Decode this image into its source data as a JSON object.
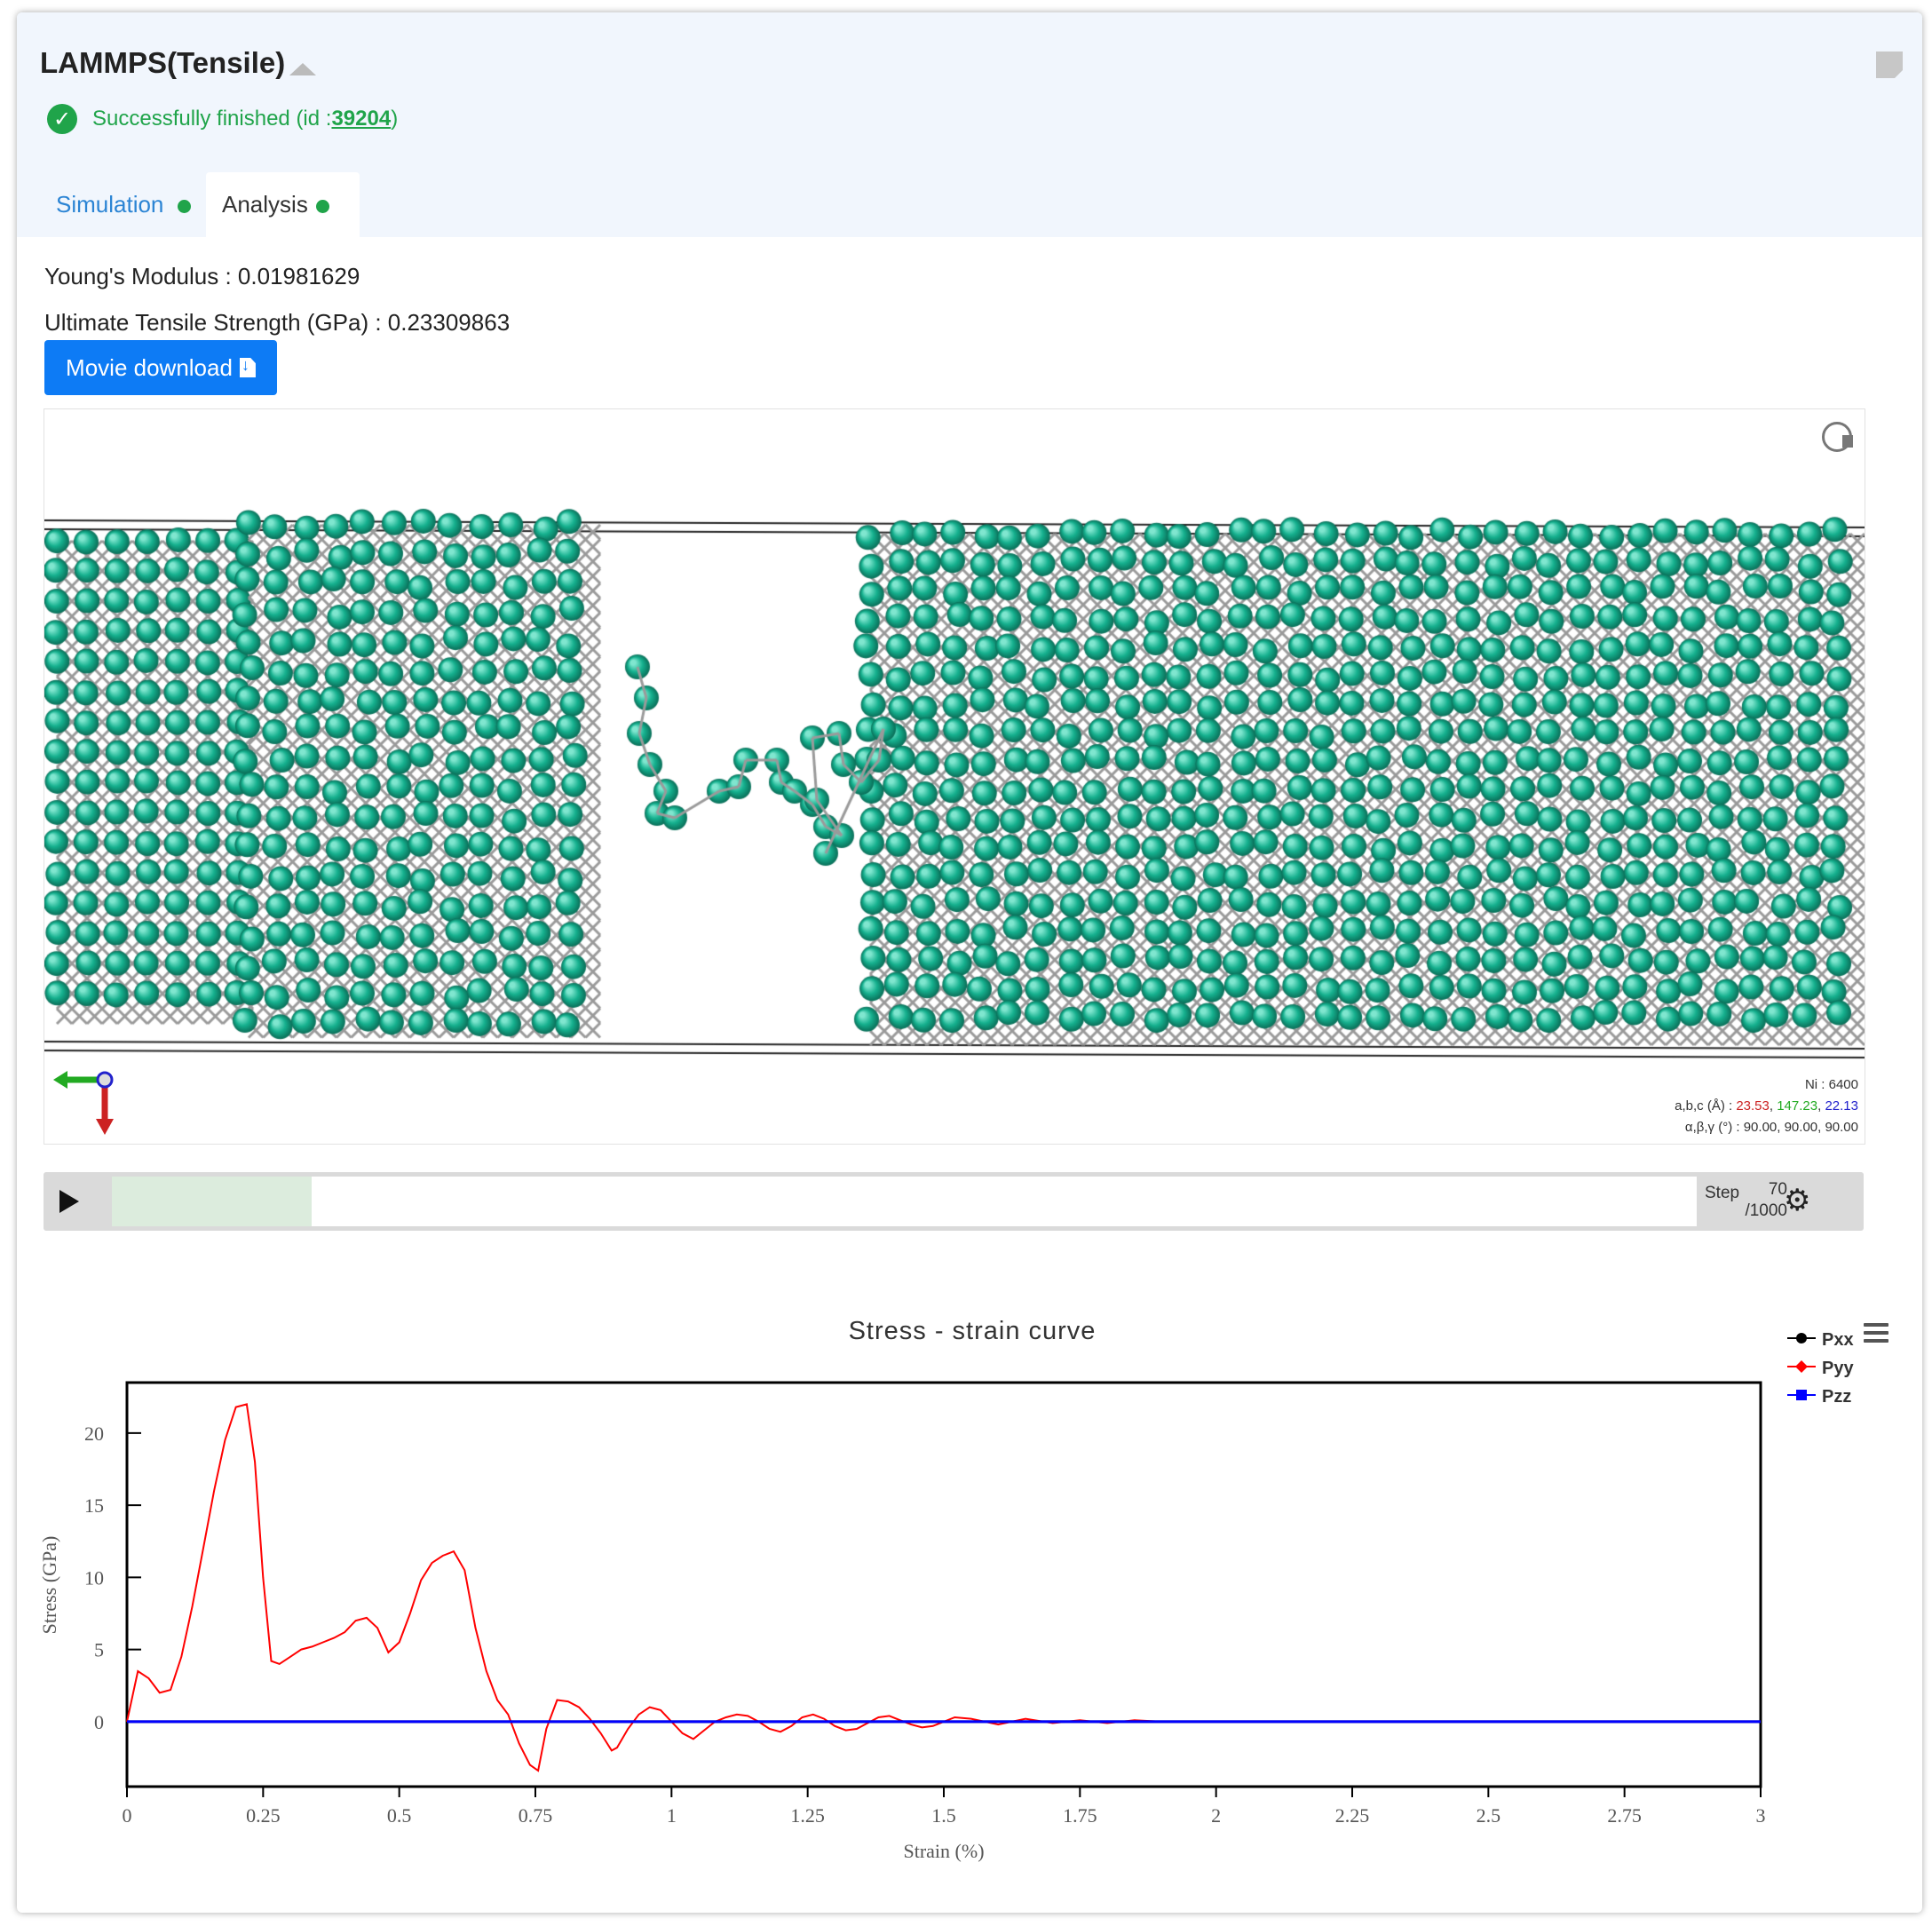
{
  "header": {
    "title": "LAMMPS(Tensile)",
    "status_prefix": "Successfully finished (id : ",
    "status_id": "39204",
    "status_suffix": ")"
  },
  "tabs": [
    {
      "label": "Simulation",
      "active": false
    },
    {
      "label": "Analysis",
      "active": true
    }
  ],
  "metrics": {
    "youngs_modulus": "Young's Modulus : 0.01981629",
    "uts": "Ultimate Tensile Strength (GPa) : 0.23309863"
  },
  "movie_button": {
    "label": "Movie download"
  },
  "viewer": {
    "atom_count": "Ni : 6400",
    "lattice_prefix": "a,b,c (Å) : ",
    "lattice_a": "23.53",
    "lattice_b": "147.23",
    "lattice_c": "22.13",
    "angles": "α,β,γ (°) : 90.00, 90.00, 90.00",
    "atom_color": "#15b08e",
    "bond_color": "#9a9a9a",
    "axis_colors": {
      "x": "#cc2222",
      "y": "#22aa22",
      "z": "#2222cc"
    }
  },
  "player": {
    "step_label": "Step",
    "step_current": "70",
    "step_total": "/1000",
    "progress": 0.07
  },
  "chart_data": {
    "type": "line",
    "title": "Stress - strain curve",
    "xlabel": "Strain (%)",
    "ylabel": "Stress (GPa)",
    "xlim": [
      0,
      3
    ],
    "ylim": [
      -4.5,
      23.5
    ],
    "xticks": [
      "0",
      "0.25",
      "0.5",
      "0.75",
      "1",
      "1.25",
      "1.5",
      "1.75",
      "2",
      "2.25",
      "2.5",
      "2.75",
      "3"
    ],
    "yticks": [
      "0",
      "5",
      "10",
      "15",
      "20"
    ],
    "legend_position": "top-right",
    "series": [
      {
        "name": "Pxx",
        "color": "#000000",
        "x": [
          0,
          0.5,
          1,
          1.5,
          2,
          2.5,
          3
        ],
        "y": [
          0,
          0,
          0,
          0,
          0,
          0,
          0
        ]
      },
      {
        "name": "Pyy",
        "color": "#ff0000",
        "x": [
          0,
          0.02,
          0.04,
          0.06,
          0.08,
          0.1,
          0.12,
          0.14,
          0.16,
          0.18,
          0.2,
          0.22,
          0.235,
          0.25,
          0.265,
          0.28,
          0.3,
          0.32,
          0.34,
          0.36,
          0.38,
          0.4,
          0.42,
          0.44,
          0.46,
          0.48,
          0.5,
          0.52,
          0.54,
          0.56,
          0.58,
          0.6,
          0.62,
          0.64,
          0.66,
          0.68,
          0.7,
          0.72,
          0.74,
          0.755,
          0.77,
          0.79,
          0.81,
          0.83,
          0.85,
          0.87,
          0.89,
          0.9,
          0.92,
          0.94,
          0.96,
          0.98,
          1.0,
          1.02,
          1.04,
          1.06,
          1.08,
          1.1,
          1.12,
          1.14,
          1.16,
          1.18,
          1.2,
          1.22,
          1.24,
          1.26,
          1.28,
          1.3,
          1.32,
          1.34,
          1.36,
          1.38,
          1.4,
          1.42,
          1.44,
          1.46,
          1.48,
          1.5,
          1.52,
          1.55,
          1.6,
          1.65,
          1.7,
          1.75,
          1.8,
          1.85,
          1.9,
          1.95,
          2.0,
          2.5,
          3.0
        ],
        "y": [
          0,
          3.5,
          3,
          2,
          2.2,
          4.5,
          8,
          12,
          16,
          19.5,
          21.8,
          22,
          18,
          10,
          4.2,
          4,
          4.5,
          5,
          5.2,
          5.5,
          5.8,
          6.2,
          7,
          7.2,
          6.5,
          4.8,
          5.5,
          7.5,
          9.8,
          11,
          11.5,
          11.8,
          10.5,
          6.5,
          3.5,
          1.5,
          0.5,
          -1.5,
          -3,
          -3.4,
          -0.5,
          1.5,
          1.4,
          1,
          0.2,
          -0.8,
          -2,
          -1.8,
          -0.5,
          0.5,
          1,
          0.8,
          0,
          -0.8,
          -1.2,
          -0.6,
          0,
          0.3,
          0.5,
          0.4,
          0,
          -0.5,
          -0.7,
          -0.3,
          0.3,
          0.5,
          0.2,
          -0.3,
          -0.6,
          -0.5,
          -0.1,
          0.3,
          0.4,
          0.1,
          -0.2,
          -0.4,
          -0.3,
          0,
          0.3,
          0.2,
          -0.2,
          0.2,
          -0.1,
          0.1,
          -0.1,
          0.1,
          0,
          0,
          0,
          0,
          0
        ]
      },
      {
        "name": "Pzz",
        "color": "#0000ff",
        "x": [
          0,
          0.5,
          1,
          1.5,
          2,
          2.5,
          3
        ],
        "y": [
          0,
          0,
          0,
          0,
          0,
          0,
          0
        ]
      }
    ]
  }
}
